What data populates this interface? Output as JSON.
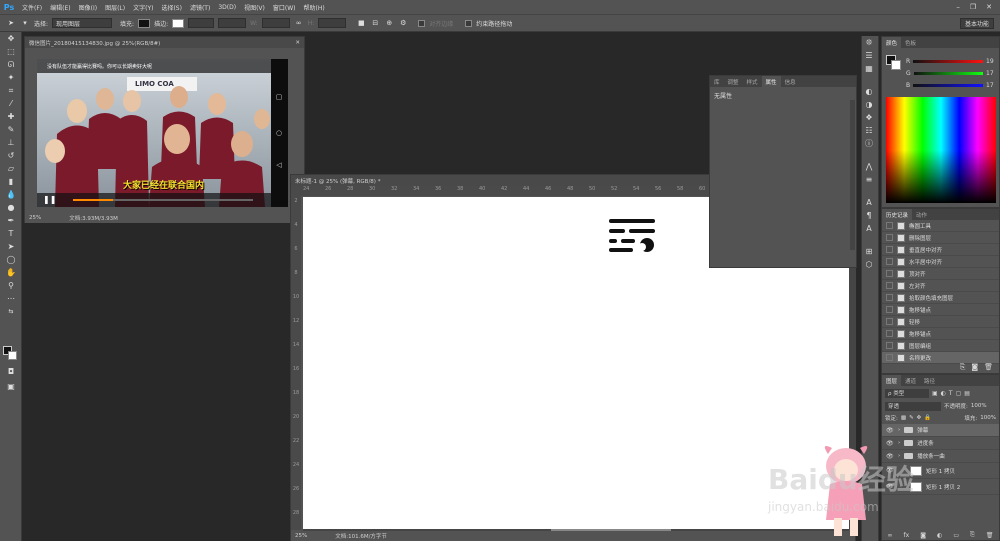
{
  "app": {
    "logo": "Ps",
    "menu": [
      "文件(F)",
      "编辑(E)",
      "图像(I)",
      "图层(L)",
      "文字(Y)",
      "选择(S)",
      "滤镜(T)",
      "3D(D)",
      "视图(V)",
      "窗口(W)",
      "帮助(H)"
    ]
  },
  "options_bar": {
    "select_label": "选择:",
    "select_value": "现用图层",
    "fill_label": "填充:",
    "stroke_label": "描边:",
    "w_label": "W:",
    "h_label": "H:",
    "align_edges": "对齐边缘",
    "constrain_path": "约束路径拖动",
    "workspace": "基本功能"
  },
  "doc1": {
    "tab": "微信图片_20180415134830.jpg @ 25%(RGB/8#)",
    "zoom": "25%",
    "doc_info": "文档:3.93M/3.93M",
    "video_top_text": "没有队伍才能赢得比赛吗。你可以长期卖好大呢",
    "subtitle": "大家已经在联合国内",
    "bus_text": "LIMO COA"
  },
  "doc2": {
    "tab": "未标题-1 @ 25% (弹幕, RGB/8) *",
    "zoom": "25%",
    "doc_info": "文档:101.6M/方字节",
    "ruler_top": [
      "24",
      "26",
      "28",
      "30",
      "32",
      "34",
      "36",
      "38",
      "40",
      "42",
      "44",
      "46",
      "48",
      "50",
      "52",
      "54",
      "56",
      "58",
      "60",
      "62",
      "64",
      "66",
      "68",
      "70",
      "72"
    ],
    "ruler_left": [
      "2",
      "4",
      "6",
      "8",
      "10",
      "12",
      "14",
      "16",
      "18",
      "20",
      "22",
      "24",
      "26",
      "28"
    ]
  },
  "properties_panel": {
    "tabs": [
      "库",
      "调整",
      "样式",
      "属性",
      "信息"
    ],
    "active": "属性",
    "content": "无属性"
  },
  "color_panel": {
    "tabs": [
      "颜色",
      "色板"
    ],
    "r_label": "R",
    "r_value": "19",
    "g_label": "G",
    "g_value": "17",
    "b_label": "B",
    "b_value": "17"
  },
  "history_panel": {
    "tabs": [
      "历史记录",
      "动作"
    ],
    "items": [
      "椭圆工具",
      "删除图层",
      "垂直居中对齐",
      "水平居中对齐",
      "顶对齐",
      "左对齐",
      "拾取颜色填充图层",
      "拖移锚点",
      "轻移",
      "拖移锚点",
      "图层编组",
      "名称更改"
    ]
  },
  "layers_panel": {
    "tabs": [
      "图层",
      "通道",
      "路径"
    ],
    "kind": "ρ 类型",
    "blend": "穿透",
    "opacity_label": "不透明度:",
    "opacity": "100%",
    "lock_label": "锁定:",
    "fill_label": "填充:",
    "fill": "100%",
    "layers": [
      "弹幕",
      "进度条",
      "播放条一曲",
      "矩形 1 拷贝",
      "矩形 1 拷贝 2"
    ]
  },
  "watermark": {
    "text": "Baidu经验",
    "url": "jingyan.baidu.com"
  },
  "colors": {
    "accent": "#31a8ff",
    "jacket": "#7a1a2a",
    "subtitle": "#f3e12c"
  }
}
